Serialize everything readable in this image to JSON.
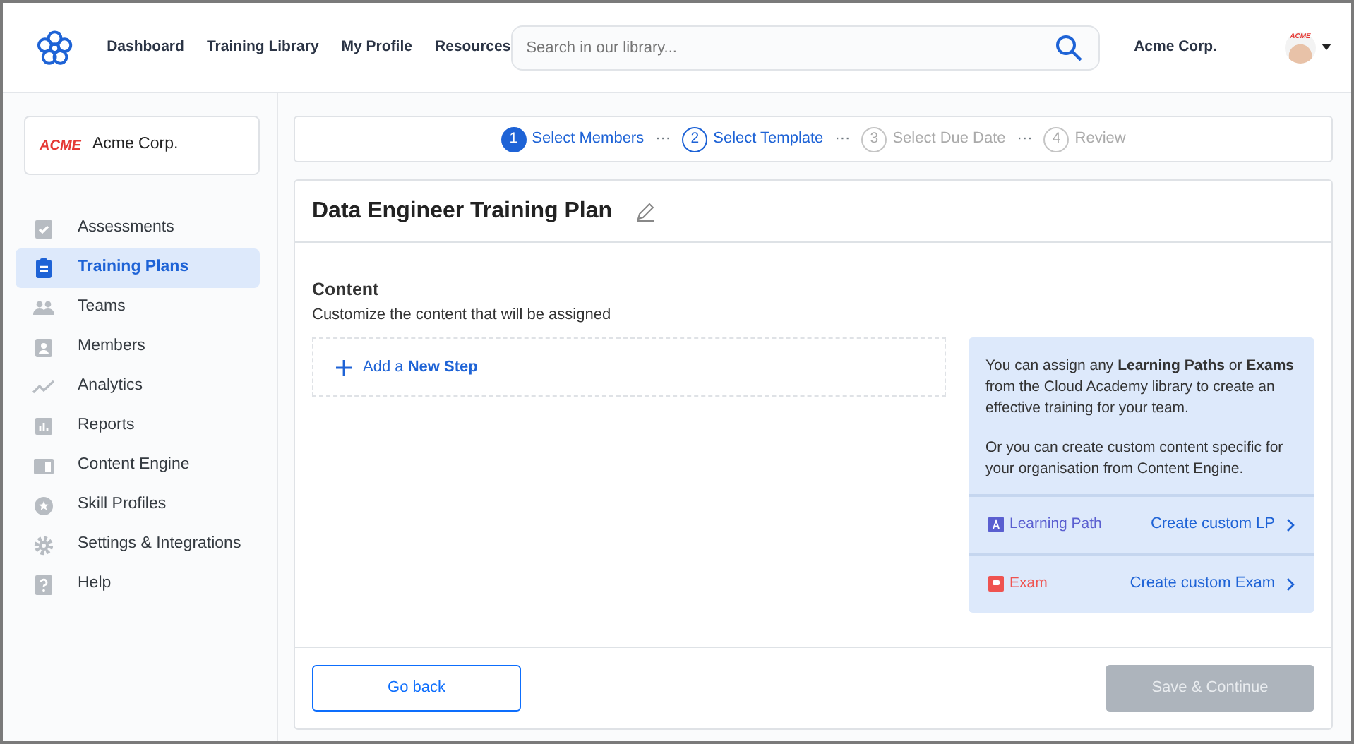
{
  "header": {
    "nav": [
      {
        "label": "Dashboard"
      },
      {
        "label": "Training Library"
      },
      {
        "label": "My Profile"
      },
      {
        "label": "Resources"
      }
    ],
    "search": {
      "placeholder": "Search in our library..."
    },
    "company": "Acme Corp.",
    "avatar_text": "ACME"
  },
  "sidebar": {
    "org": {
      "logo": "ACME",
      "name": "Acme Corp."
    },
    "items": [
      {
        "label": "Assessments",
        "selected": false
      },
      {
        "label": "Training Plans",
        "selected": true
      },
      {
        "label": "Teams",
        "selected": false
      },
      {
        "label": "Members",
        "selected": false
      },
      {
        "label": "Analytics",
        "selected": false
      },
      {
        "label": "Reports",
        "selected": false
      },
      {
        "label": "Content Engine",
        "selected": false
      },
      {
        "label": "Skill Profiles",
        "selected": false
      },
      {
        "label": "Settings & Integrations",
        "selected": false
      },
      {
        "label": "Help",
        "selected": false
      }
    ]
  },
  "steps": [
    {
      "number": "1",
      "label": "Select Members",
      "selected": true,
      "disabled": false
    },
    {
      "number": "2",
      "label": "Select Template",
      "selected": false,
      "disabled": false
    },
    {
      "number": "3",
      "label": "Select Due Date",
      "selected": false,
      "disabled": true
    },
    {
      "number": "4",
      "label": "Review",
      "selected": false,
      "disabled": true
    }
  ],
  "step_separator": "···",
  "plan": {
    "title": "Data Engineer Training Plan",
    "content_heading": "Content",
    "content_subtitle": "Customize the content that will be assigned",
    "add_step": "Add a **New Step**",
    "info": {
      "paragraphs": [
        "You can assign any **Learning Paths** or **Exams** from the Cloud Academy library to create an effective training for your team.",
        "Or you can create custom content specific for your organisation from Content Engine."
      ],
      "rows": [
        {
          "kind": "learning_path",
          "label": "Learning Path",
          "link": "Create custom LP",
          "color": "#5a5fd0"
        },
        {
          "kind": "exam",
          "label": "Exam",
          "link": "Create custom Exam",
          "color": "#ef5350"
        }
      ]
    }
  },
  "footer": {
    "back": "Go back",
    "save": {
      "label": "Save & Continue",
      "disabled": true
    }
  }
}
